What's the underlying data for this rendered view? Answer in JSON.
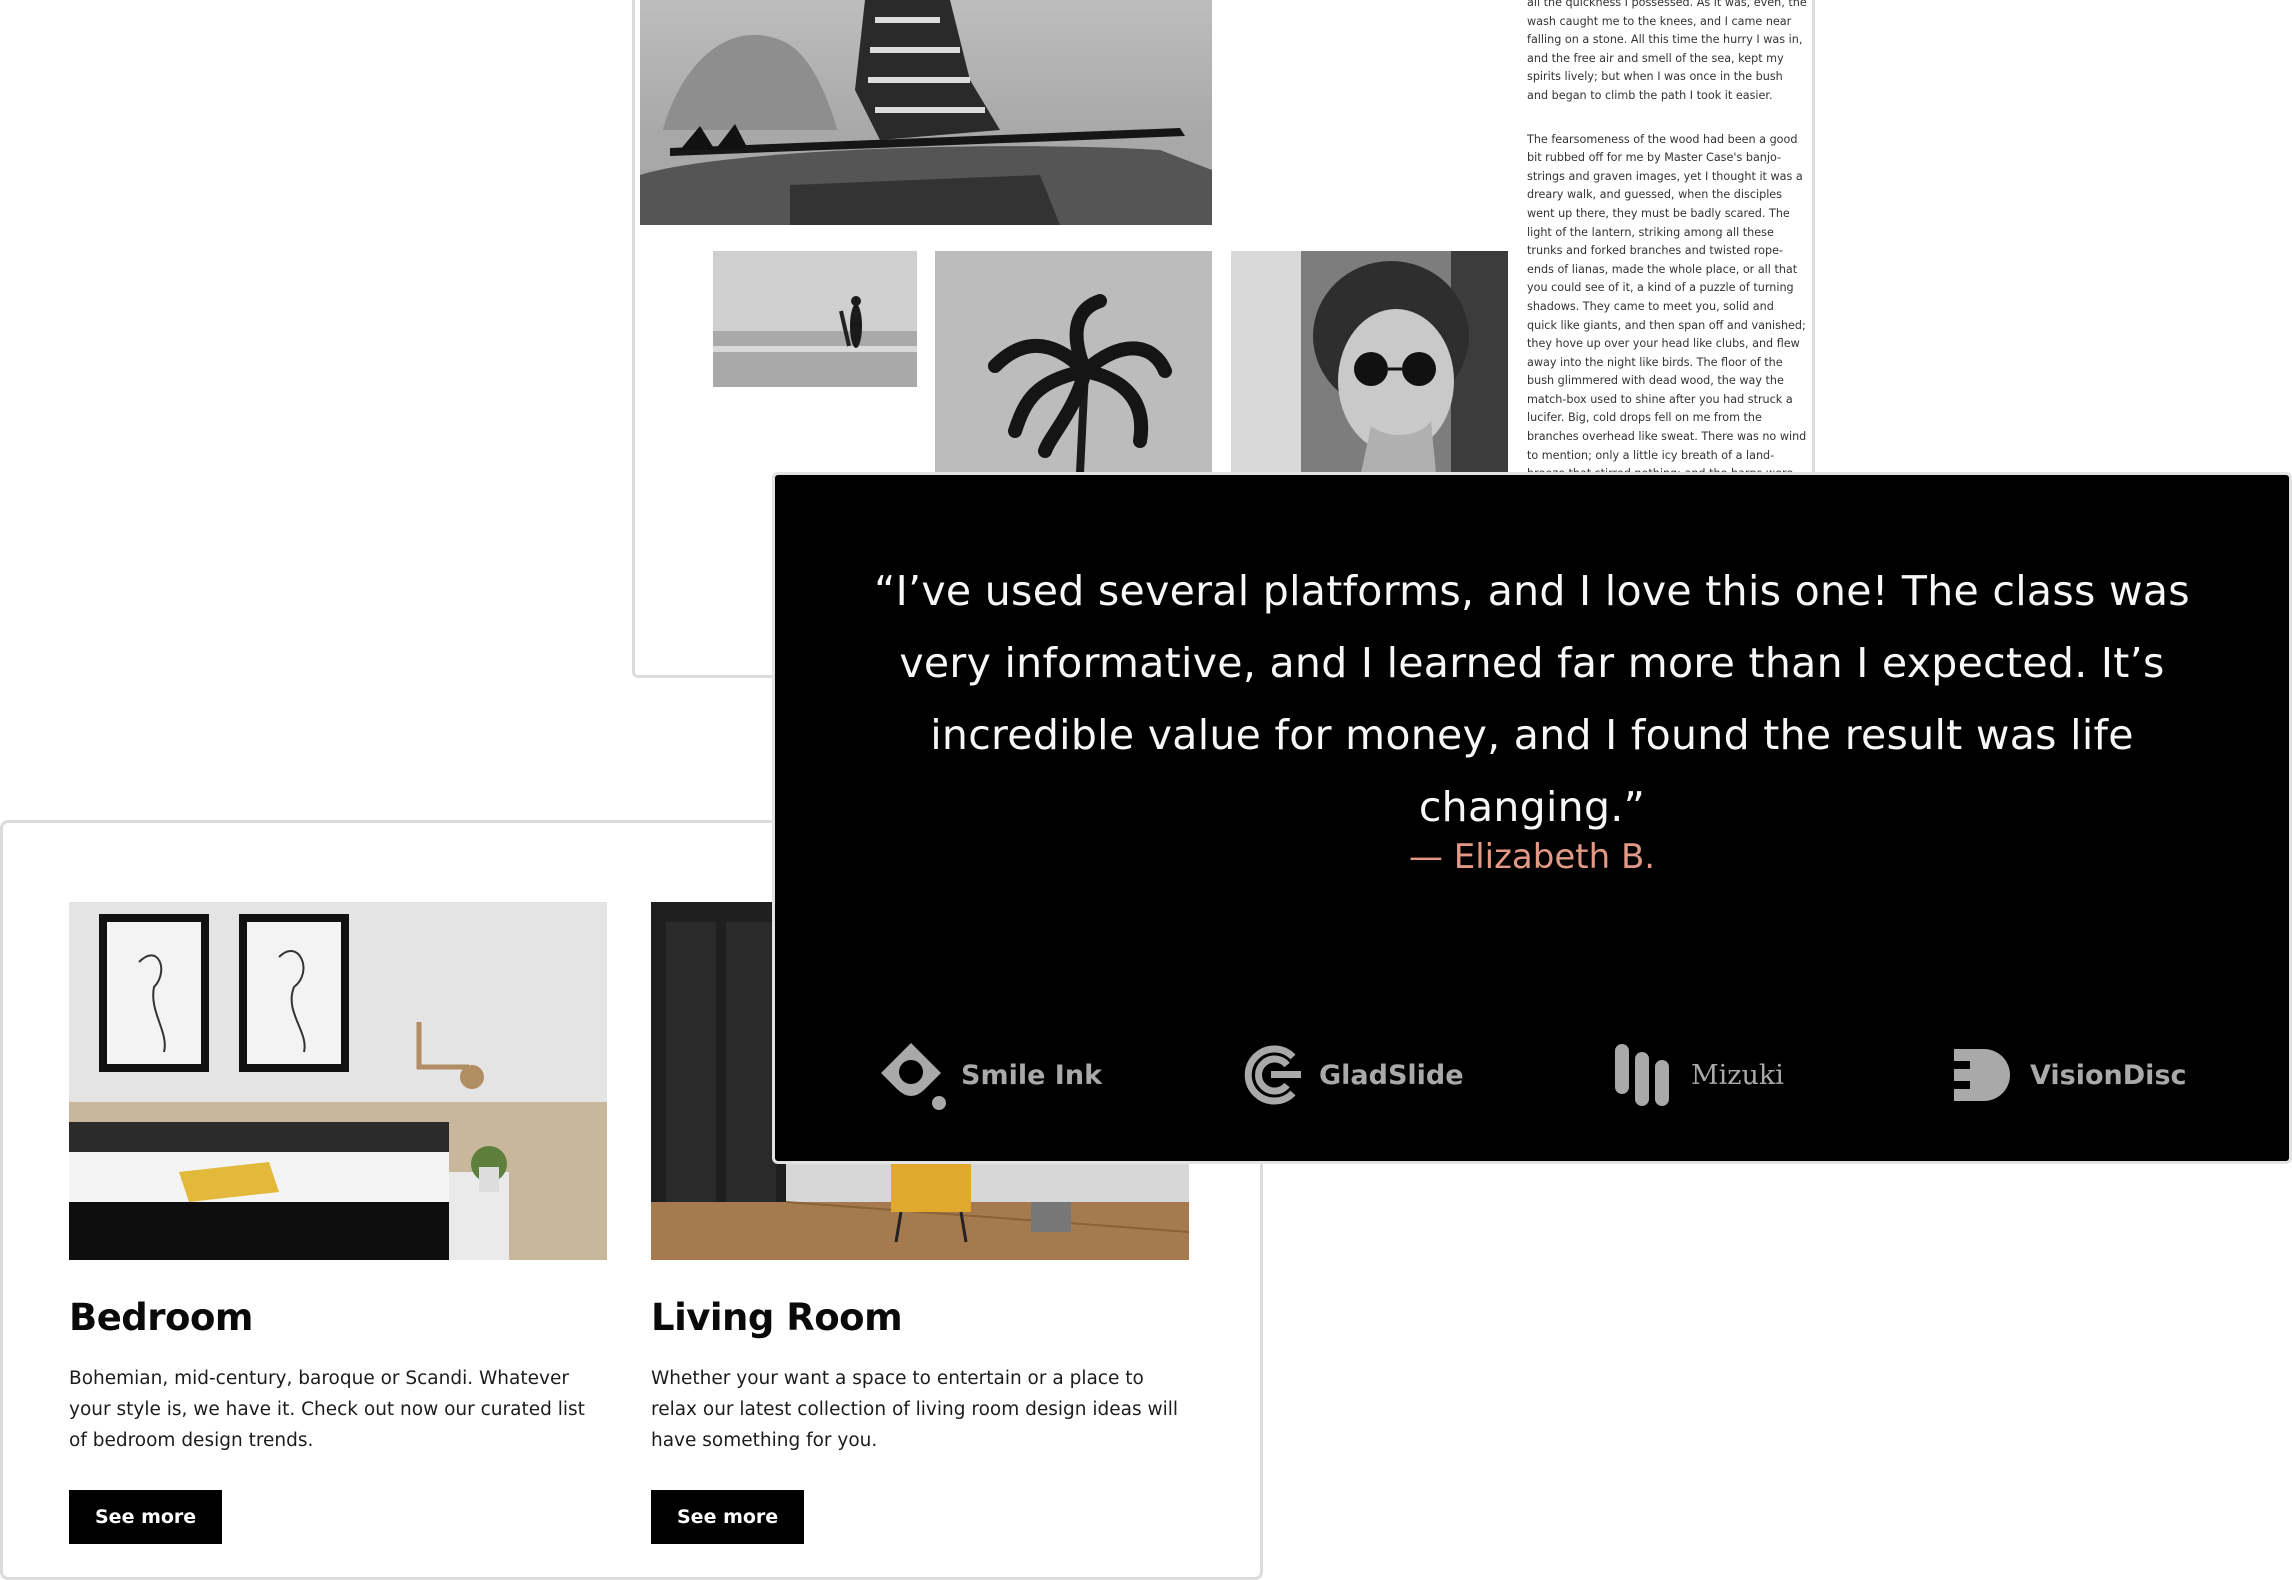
{
  "story": {
    "paragraph_1": "all the quickness I possessed. As it was, even, the wash caught me to the knees, and I came near falling on a stone. All this time the hurry I was in, and the free air and smell of the sea, kept my spirits lively; but when I was once in the bush and began to climb the path I took it easier.",
    "paragraph_2": "The fearsomeness of the wood had been a good bit rubbed off for me by Master Case's banjo-strings and graven images, yet I thought it was a dreary walk, and guessed, when the disciples went up there, they must be badly scared. The light of the lantern, striking among all these trunks and forked branches and twisted rope-ends of lianas, made the whole place, or all that you could see of it, a kind of a puzzle of turning shadows. They came to meet you, solid and quick like giants, and then span off and vanished; they hove up over your head like clubs, and flew away into the night like birds. The floor of the bush glimmered with dead wood, the way the match-box used to shine after you had struck a lucifer. Big, cold drops fell on me from the branches overhead like sweat. There was no wind to mention; only a little icy breath of a land-breeze that stirred nothing; and the harps were silent."
  },
  "testimonial": {
    "quote": "“I’ve used several platforms, and I love this one! The class was very informative, and I learned far more than I expected. It’s incredible value for money, and I found the result was life changing.”",
    "author": "— Elizabeth B.",
    "author_color": "#e39985",
    "logos": [
      {
        "name": "Smile Ink",
        "icon": "smile-ink-logo"
      },
      {
        "name": "GladSlide",
        "icon": "gladslide-logo"
      },
      {
        "name": "Mizuki",
        "icon": "mizuki-logo"
      },
      {
        "name": "VisionDisc",
        "icon": "visiondisc-logo"
      }
    ]
  },
  "rooms": [
    {
      "title": "Bedroom",
      "description": "Bohemian, mid-century, baroque or Scandi. Whatever your style is, we have it. Check out now our curated list of bedroom design trends.",
      "button": "See more"
    },
    {
      "title": "Living Room",
      "description": "Whether your want a space to entertain or a place to relax our latest collection of living room design ideas will have something for you.",
      "button": "See more"
    }
  ]
}
